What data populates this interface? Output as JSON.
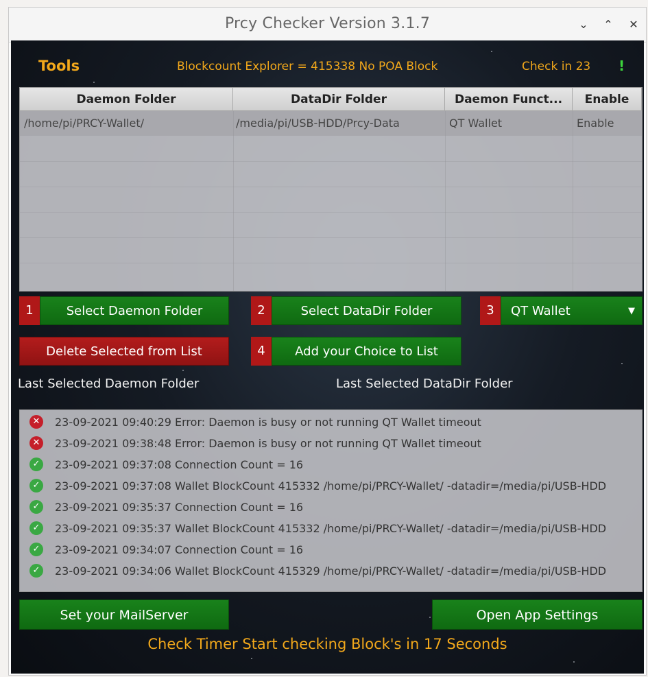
{
  "window": {
    "title": "Prcy Checker Version 3.1.7"
  },
  "window_controls": {
    "minimize": "⌄",
    "maximize": "⌃",
    "close": "✕"
  },
  "header": {
    "tools": "Tools",
    "blockcount": "Blockcount Explorer = 415338 No POA Block",
    "check": "Check in 23",
    "indicator": "!"
  },
  "table": {
    "columns": [
      "Daemon Folder",
      "DataDir Folder",
      "Daemon Funct...",
      "Enable"
    ],
    "rows": [
      [
        "/home/pi/PRCY-Wallet/",
        "/media/pi/USB-HDD/Prcy-Data",
        "QT Wallet",
        "Enable"
      ]
    ]
  },
  "buttons": {
    "step1_num": "1",
    "select_daemon": "Select Daemon Folder",
    "step2_num": "2",
    "select_datadir": "Select DataDir Folder",
    "step3_num": "3",
    "function_select": "QT Wallet",
    "delete_selected": "Delete Selected from List",
    "step4_num": "4",
    "add_choice": "Add your Choice  to List",
    "mailserver": "Set your MailServer",
    "app_settings": "Open App Settings"
  },
  "labels": {
    "last_daemon": "Last Selected Daemon Folder",
    "last_datadir": "Last Selected DataDir Folder"
  },
  "log": [
    {
      "type": "error",
      "text": "23-09-2021 09:40:29 Error: Daemon is busy or not running QT Wallet timeout"
    },
    {
      "type": "error",
      "text": "23-09-2021 09:38:48 Error: Daemon is busy or not running QT Wallet timeout"
    },
    {
      "type": "ok",
      "text": "23-09-2021 09:37:08 Connection Count = 16"
    },
    {
      "type": "ok",
      "text": "23-09-2021 09:37:08 Wallet BlockCount 415332  /home/pi/PRCY-Wallet/  -datadir=/media/pi/USB-HDD"
    },
    {
      "type": "ok",
      "text": "23-09-2021 09:35:37 Connection Count = 16"
    },
    {
      "type": "ok",
      "text": "23-09-2021 09:35:37 Wallet BlockCount 415332  /home/pi/PRCY-Wallet/  -datadir=/media/pi/USB-HDD"
    },
    {
      "type": "ok",
      "text": "23-09-2021 09:34:07 Connection Count = 16"
    },
    {
      "type": "ok",
      "text": "23-09-2021 09:34:06 Wallet BlockCount 415329  /home/pi/PRCY-Wallet/  -datadir=/media/pi/USB-HDD"
    }
  ],
  "status": "Check Timer Start checking Block's in 17 Seconds",
  "colors": {
    "accent": "#f2a81b",
    "button_green": "#137a15",
    "button_red": "#a51818",
    "indicator_green": "#3cd43c"
  }
}
